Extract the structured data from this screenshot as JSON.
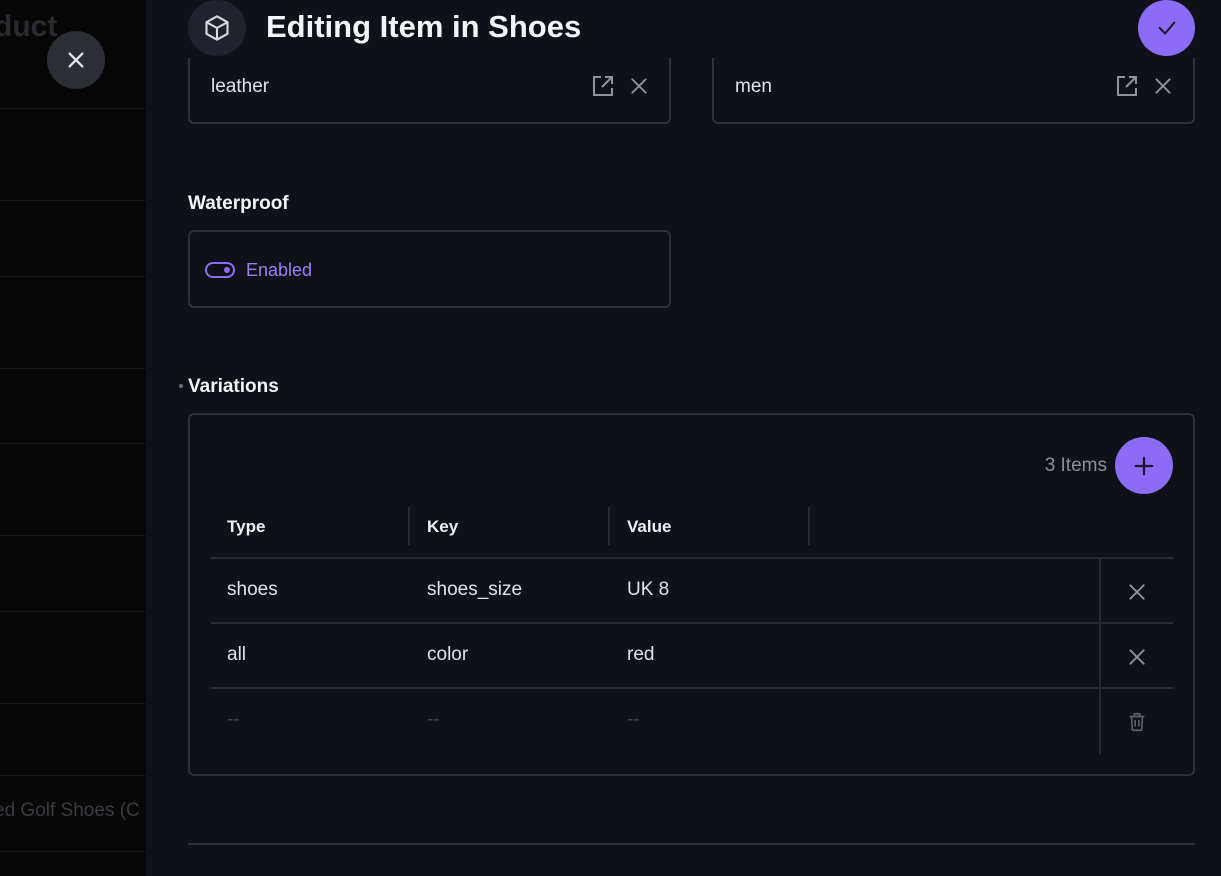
{
  "background": {
    "title_fragment": "duct",
    "list_text_fragment": "ed Golf Shoes (C"
  },
  "header": {
    "title": "Editing Item in Shoes",
    "icon": "cube-icon",
    "save_icon": "check-icon"
  },
  "relations": [
    {
      "value": "leather",
      "open_icon": "open-in-new-icon",
      "remove_icon": "close-icon"
    },
    {
      "value": "men",
      "open_icon": "open-in-new-icon",
      "remove_icon": "close-icon"
    }
  ],
  "waterproof": {
    "label": "Waterproof",
    "status": "Enabled",
    "enabled": true
  },
  "variations": {
    "label": "Variations",
    "required": true,
    "count_label": "3 Items",
    "columns": [
      "Type",
      "Key",
      "Value"
    ],
    "rows": [
      {
        "type": "shoes",
        "key": "shoes_size",
        "value": "UK 8",
        "action": "close-icon"
      },
      {
        "type": "all",
        "key": "color",
        "value": "red",
        "action": "close-icon"
      },
      {
        "type": "--",
        "key": "--",
        "value": "--",
        "action": "trash-icon"
      }
    ]
  },
  "colors": {
    "accent": "#8c6cf4",
    "panel": "#0f1118",
    "border": "#2d313a"
  }
}
